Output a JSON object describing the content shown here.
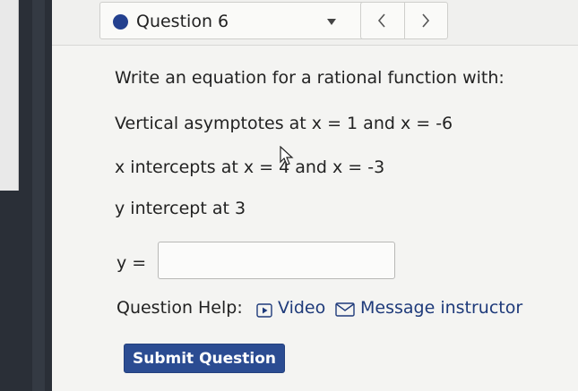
{
  "question_header": {
    "title": "Question 6",
    "status_color": "#23408e",
    "dropdown_icon": "caret-down-icon",
    "prev_icon": "chevron-left-icon",
    "next_icon": "chevron-right-icon"
  },
  "problem": {
    "prompt": "Write an equation for a rational function with:",
    "vertical_asymptotes": "Vertical asymptotes at x = 1 and x = -6",
    "x_intercepts": "x intercepts at x = 4 and x = -3",
    "y_intercept": "y intercept at 3"
  },
  "answer": {
    "label": "y =",
    "value": "",
    "placeholder": ""
  },
  "help": {
    "label": "Question Help:",
    "video_label": "Video",
    "video_icon": "video-icon",
    "message_label": "Message instructor",
    "message_icon": "envelope-icon"
  },
  "submit": {
    "label": "Submit Question",
    "color": "#2b4c92"
  }
}
